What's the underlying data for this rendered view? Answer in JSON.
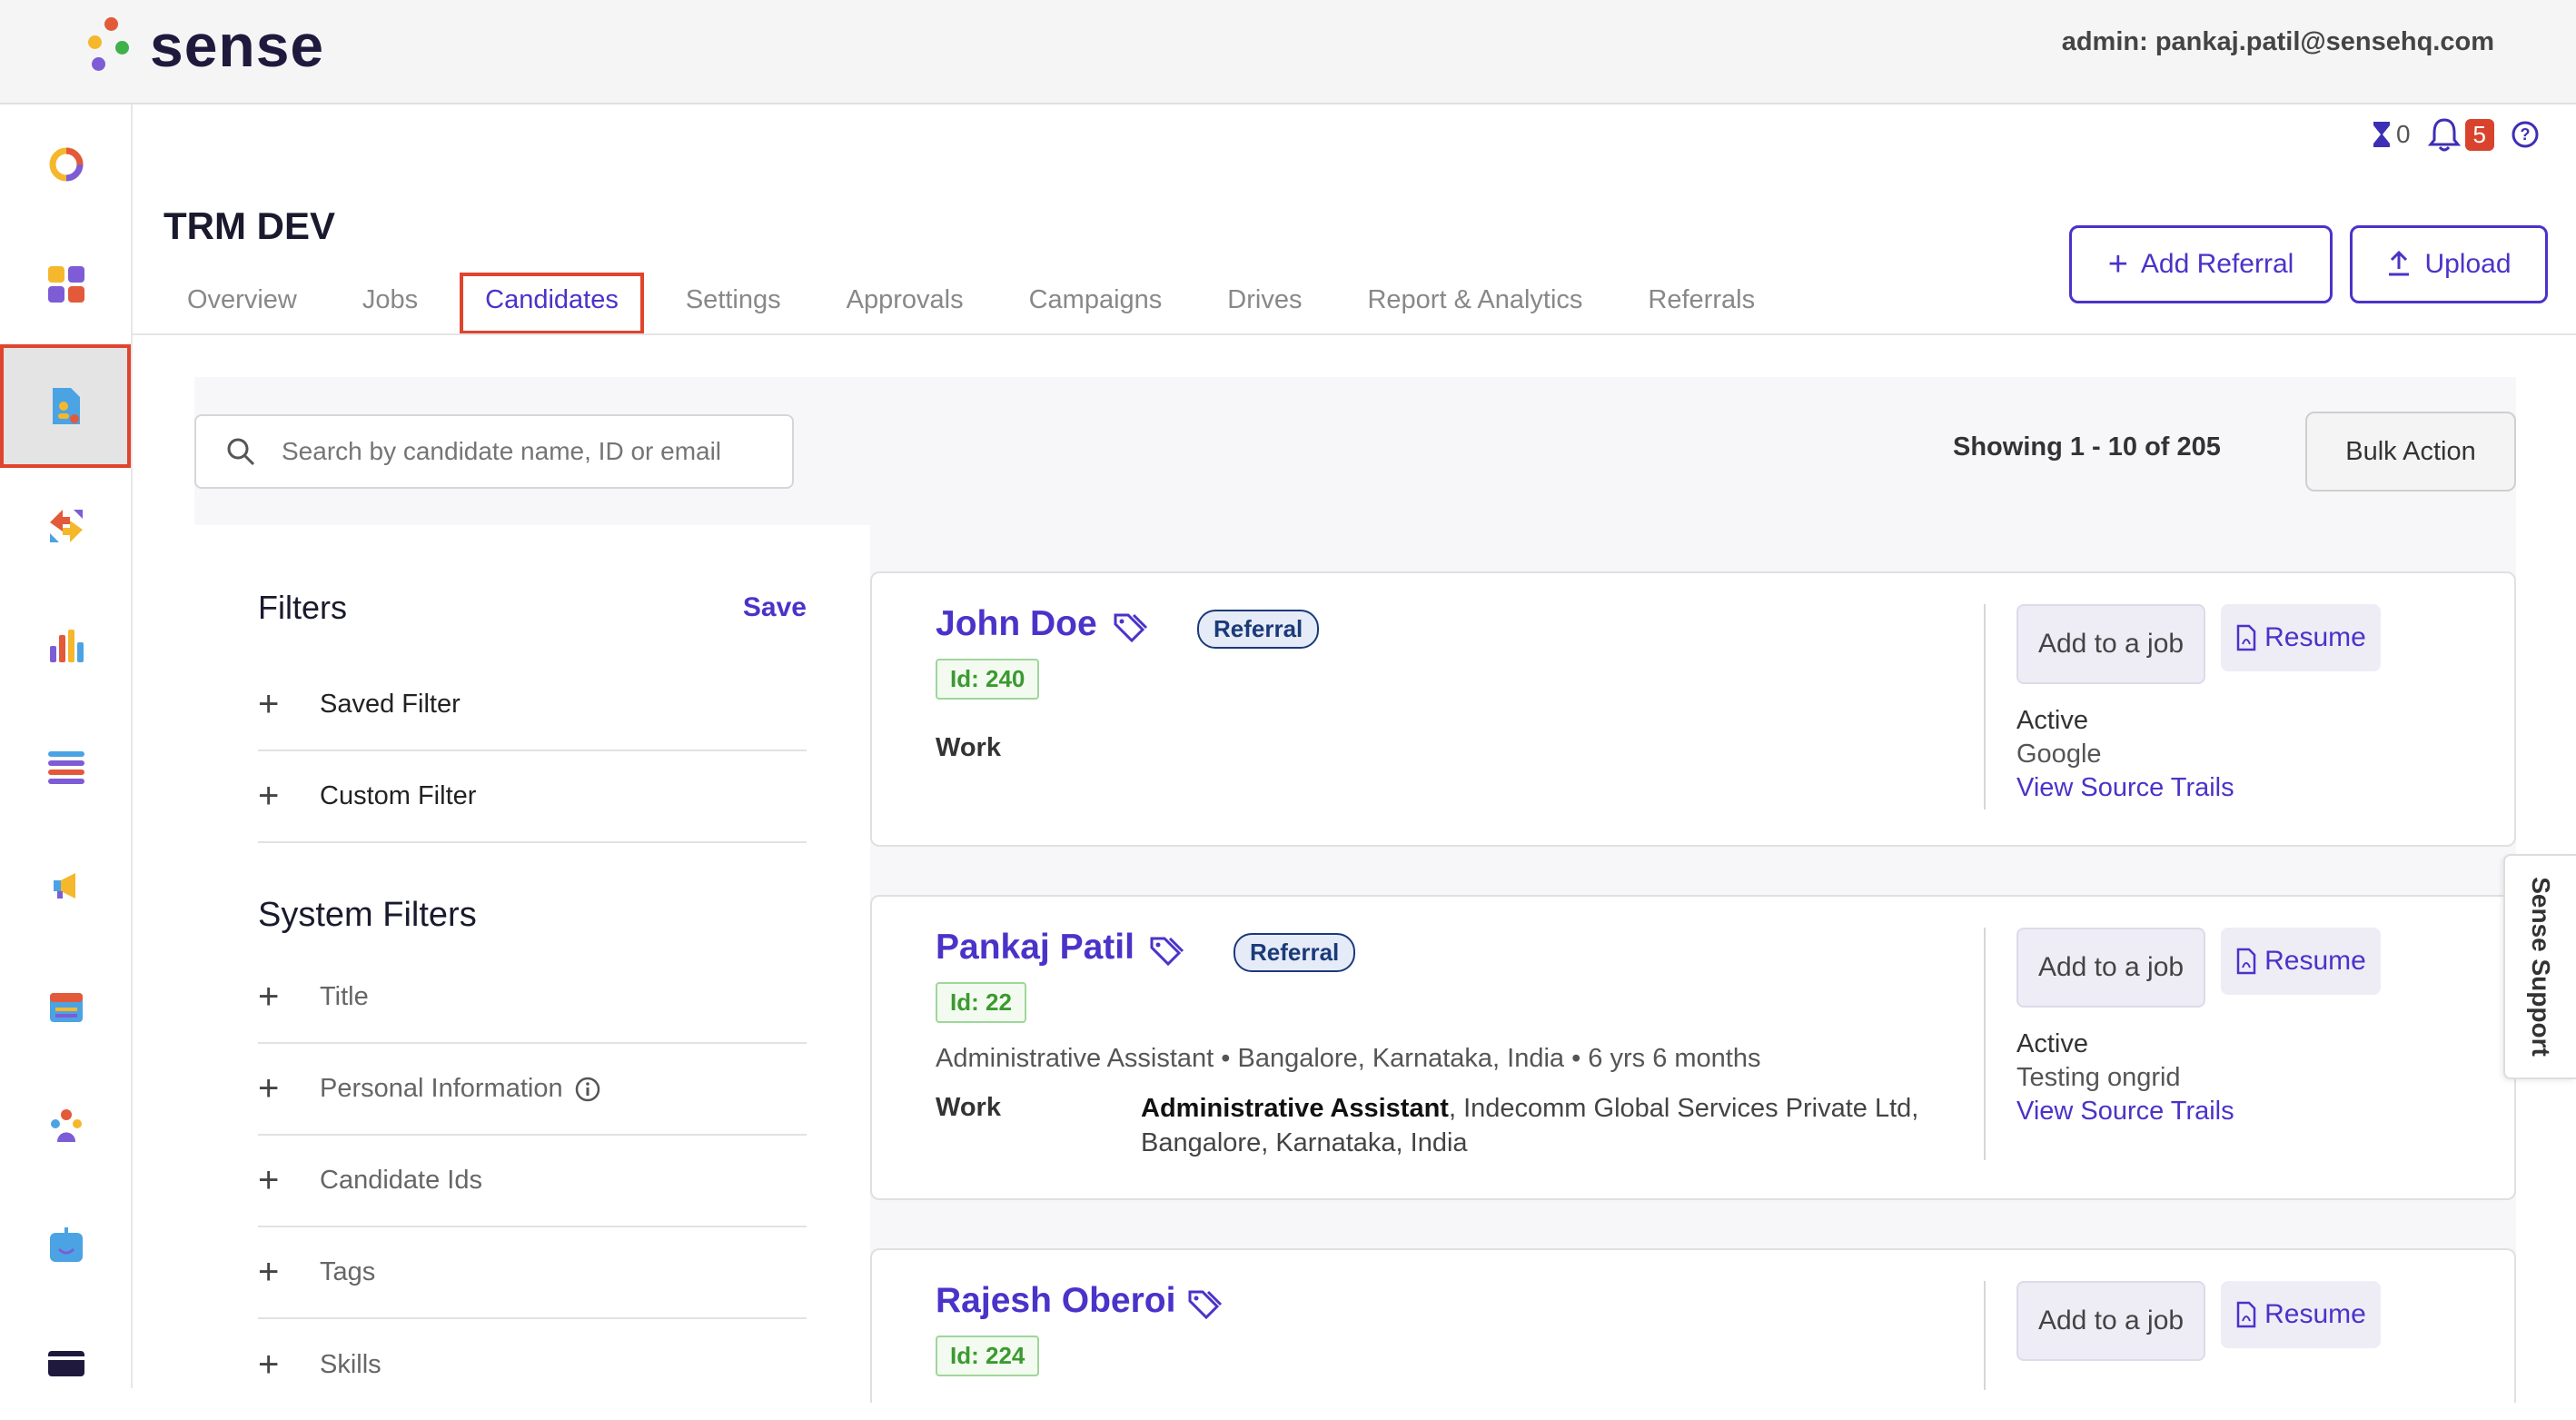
{
  "header": {
    "logo_text": "sense",
    "admin": "admin: pankaj.patil@sensehq.com"
  },
  "util": {
    "hourglass_count": "0",
    "notifications": "5"
  },
  "page": {
    "title": "TRM DEV"
  },
  "tabs": [
    {
      "label": "Overview"
    },
    {
      "label": "Jobs"
    },
    {
      "label": "Candidates"
    },
    {
      "label": "Settings"
    },
    {
      "label": "Approvals"
    },
    {
      "label": "Campaigns"
    },
    {
      "label": "Drives"
    },
    {
      "label": "Report & Analytics"
    },
    {
      "label": "Referrals"
    }
  ],
  "actions": {
    "add_referral": "Add Referral",
    "upload": "Upload",
    "bulk_action": "Bulk Action"
  },
  "search": {
    "placeholder": "Search by candidate name, ID or email"
  },
  "showing": "Showing 1 - 10 of 205",
  "filters": {
    "title": "Filters",
    "save": "Save",
    "items": [
      "Saved Filter",
      "Custom Filter"
    ],
    "system_title": "System Filters",
    "system_items": [
      "Title",
      "Personal Information",
      "Candidate Ids",
      "Tags",
      "Skills"
    ]
  },
  "candidates": [
    {
      "name": "John Doe",
      "badge": "Referral",
      "id": "Id: 240",
      "work_label": "Work",
      "status": "Active",
      "source": "Google",
      "trail": "View Source Trails",
      "add_job": "Add to a job",
      "resume": "Resume"
    },
    {
      "name": "Pankaj Patil",
      "badge": "Referral",
      "id": "Id: 22",
      "meta": "Administrative Assistant • Bangalore, Karnataka, India • 6 yrs 6 months",
      "work_label": "Work",
      "work_title": "Administrative Assistant",
      "work_rest": ", Indecomm Global Services Private Ltd, Bangalore, Karnataka, India",
      "status": "Active",
      "source": "Testing ongrid",
      "trail": "View Source Trails",
      "add_job": "Add to a job",
      "resume": "Resume"
    },
    {
      "name": "Rajesh Oberoi",
      "id": "Id: 224",
      "add_job": "Add to a job",
      "resume": "Resume"
    }
  ],
  "support": "Sense Support",
  "colors": {
    "accent": "#4a33c9",
    "highlight": "#e0442d",
    "id_green": "#3b9a2f"
  }
}
